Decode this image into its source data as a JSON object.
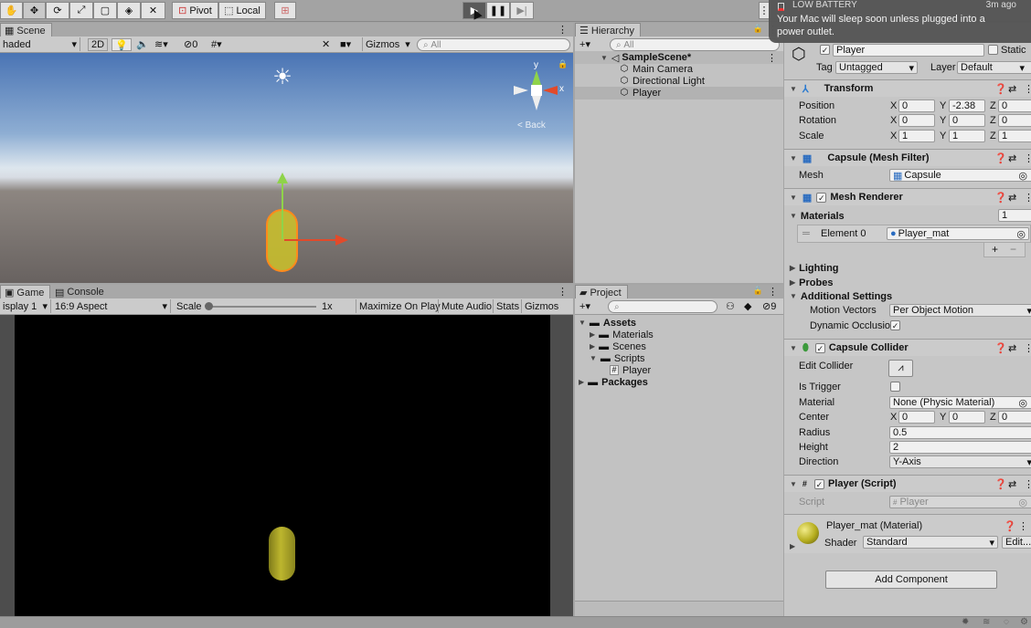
{
  "toolbar": {
    "tools": [
      "hand-tool",
      "move-tool",
      "rotate-tool",
      "scale-tool",
      "rect-tool",
      "transform-tool",
      "custom-tool"
    ],
    "pivot": "Pivot",
    "local": "Local"
  },
  "notification": {
    "title": "LOW BATTERY",
    "time": "3m ago",
    "message": "Your Mac will sleep soon unless plugged into a power outlet."
  },
  "scene": {
    "tab": "Scene",
    "shading": "haded",
    "mode_2d": "2D",
    "fx": "0",
    "gizmos": "Gizmos",
    "search": "All",
    "back": "< Back",
    "axis_y": "y",
    "axis_x": "x"
  },
  "game": {
    "tab": "Game",
    "console_tab": "Console",
    "display": "isplay 1",
    "aspect": "16:9 Aspect",
    "scale_label": "Scale",
    "scale_value": "1x",
    "maximize": "Maximize On Play",
    "mute": "Mute Audio",
    "stats": "Stats",
    "gizmos": "Gizmos"
  },
  "hierarchy": {
    "tab": "Hierarchy",
    "search": "All",
    "scene": "SampleScene*",
    "items": [
      "Main Camera",
      "Directional Light",
      "Player"
    ]
  },
  "project": {
    "tab": "Project",
    "count": "9",
    "assets": "Assets",
    "folders": [
      "Materials",
      "Scenes",
      "Scripts"
    ],
    "script": "Player",
    "packages": "Packages"
  },
  "inspector": {
    "name": "Player",
    "static": "Static",
    "tag_label": "Tag",
    "tag": "Untagged",
    "layer_label": "Layer",
    "layer": "Default",
    "transform": {
      "title": "Transform",
      "position": {
        "label": "Position",
        "x": "0",
        "y": "-2.38",
        "z": "0"
      },
      "rotation": {
        "label": "Rotation",
        "x": "0",
        "y": "0",
        "z": "0"
      },
      "scale": {
        "label": "Scale",
        "x": "1",
        "y": "1",
        "z": "1"
      }
    },
    "mesh_filter": {
      "title": "Capsule (Mesh Filter)",
      "mesh_label": "Mesh",
      "mesh": "Capsule"
    },
    "mesh_renderer": {
      "title": "Mesh Renderer",
      "materials": "Materials",
      "count": "1",
      "element": "Element 0",
      "material": "Player_mat",
      "lighting": "Lighting",
      "probes": "Probes",
      "additional": "Additional Settings",
      "motion_label": "Motion Vectors",
      "motion": "Per Object Motion",
      "occlusion": "Dynamic Occlusio"
    },
    "collider": {
      "title": "Capsule Collider",
      "edit": "Edit Collider",
      "trigger": "Is Trigger",
      "material_label": "Material",
      "material": "None (Physic Material)",
      "center": "Center",
      "cx": "0",
      "cy": "0",
      "cz": "0",
      "radius_label": "Radius",
      "radius": "0.5",
      "height_label": "Height",
      "height": "2",
      "direction_label": "Direction",
      "direction": "Y-Axis"
    },
    "script": {
      "title": "Player (Script)",
      "label": "Script",
      "value": "Player"
    },
    "material": {
      "title": "Player_mat (Material)",
      "shader_label": "Shader",
      "shader": "Standard",
      "edit": "Edit..."
    },
    "add_component": "Add Component"
  },
  "axis": {
    "x": "X",
    "y": "Y",
    "z": "Z"
  },
  "colors": {
    "accent": "#3a72d8",
    "selection": "#bcbcbc",
    "capsule": "#c7bf2b",
    "gizmo_x": "#e24a2a",
    "gizmo_y": "#8fd34a"
  }
}
